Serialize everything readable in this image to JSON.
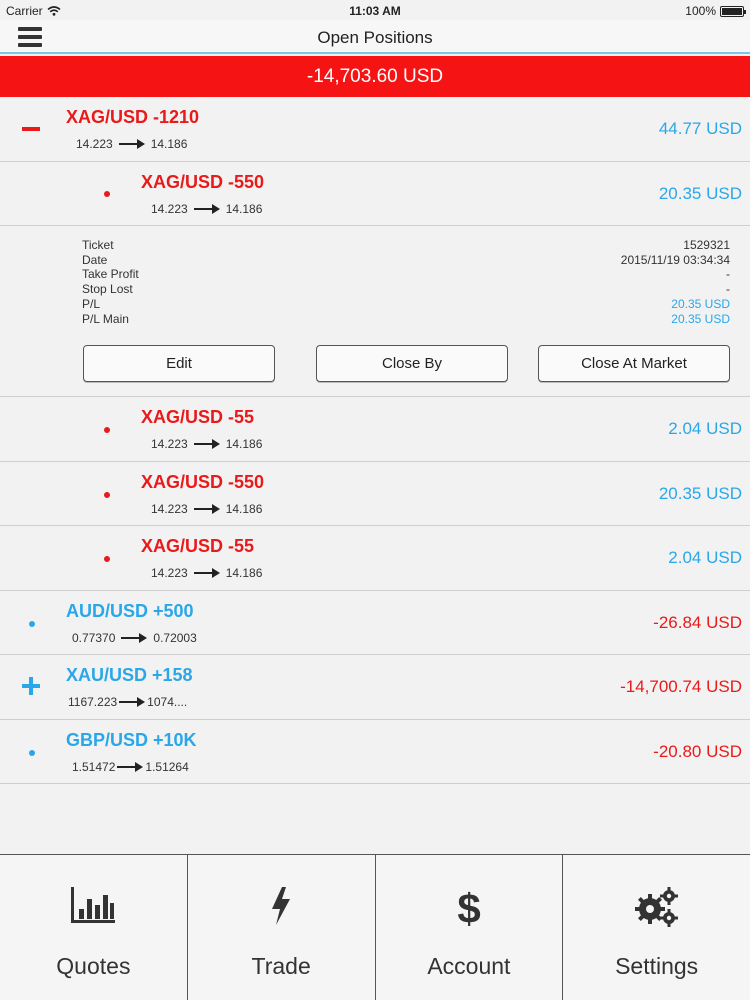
{
  "status": {
    "carrier": "Carrier",
    "time": "11:03 AM",
    "battery": "100%"
  },
  "nav": {
    "title": "Open Positions"
  },
  "total": "-14,703.60 USD",
  "positions": [
    {
      "symbol": "XAG/USD -1210",
      "open": "14.223",
      "current": "14.186",
      "pl": "44.77 USD"
    },
    {
      "symbol": "XAG/USD -550",
      "open": "14.223",
      "current": "14.186",
      "pl": "20.35 USD"
    },
    {
      "symbol": "XAG/USD -55",
      "open": "14.223",
      "current": "14.186",
      "pl": "2.04 USD"
    },
    {
      "symbol": "XAG/USD -550",
      "open": "14.223",
      "current": "14.186",
      "pl": "20.35 USD"
    },
    {
      "symbol": "XAG/USD -55",
      "open": "14.223",
      "current": "14.186",
      "pl": "2.04 USD"
    },
    {
      "symbol": "AUD/USD +500",
      "open": "0.77370",
      "current": "0.72003",
      "pl": "-26.84 USD"
    },
    {
      "symbol": "XAU/USD +158",
      "open": "1167.223",
      "current": "1074....",
      "pl": "-14,700.74 USD"
    },
    {
      "symbol": "GBP/USD +10K",
      "open": "1.51472",
      "current": "1.51264",
      "pl": "-20.80 USD"
    }
  ],
  "detail": {
    "fields": [
      {
        "label": "Ticket",
        "value": "1529321"
      },
      {
        "label": "Date",
        "value": "2015/11/19 03:34:34"
      },
      {
        "label": "Take Profit",
        "value": "-"
      },
      {
        "label": "Stop Lost",
        "value": "-"
      },
      {
        "label": "P/L",
        "value": "20.35 USD"
      },
      {
        "label": "P/L Main",
        "value": "20.35 USD"
      }
    ],
    "buttons": {
      "edit": "Edit",
      "close_by": "Close By",
      "close_market": "Close At Market"
    }
  },
  "tabs": [
    {
      "label": "Quotes",
      "icon": "bar-chart-icon"
    },
    {
      "label": "Trade",
      "icon": "lightning-icon"
    },
    {
      "label": "Account",
      "icon": "dollar-icon"
    },
    {
      "label": "Settings",
      "icon": "gears-icon"
    }
  ],
  "colors": {
    "loss": "#e81a1a",
    "gain": "#29a7e9",
    "total_bar": "#f51313",
    "nav_line": "#7fc4e6"
  }
}
